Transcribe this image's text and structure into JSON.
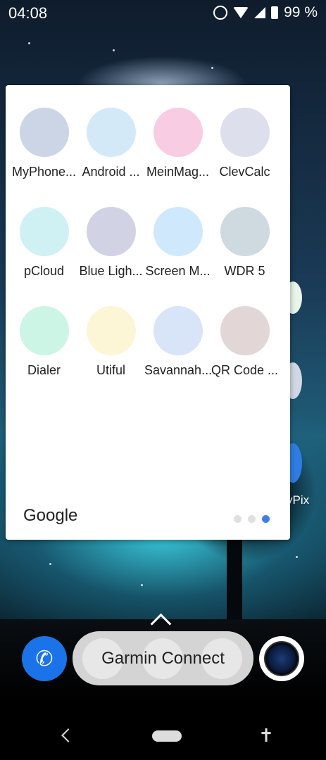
{
  "status_bar": {
    "time": "04:08",
    "battery": "99 %",
    "icons": [
      "alarm-icon",
      "wifi-icon",
      "signal-icon",
      "battery-icon"
    ]
  },
  "folder": {
    "name": "Google",
    "apps": [
      {
        "label": "MyPhone...",
        "color": "#cbd5e6"
      },
      {
        "label": "Android ...",
        "color": "#d4e9f8"
      },
      {
        "label": "MeinMag...",
        "color": "#f8cde3"
      },
      {
        "label": "ClevCalc",
        "color": "#dde0ec"
      },
      {
        "label": "pCloud",
        "color": "#cff1f3"
      },
      {
        "label": "Blue Ligh...",
        "color": "#d1d3e5"
      },
      {
        "label": "Screen M...",
        "color": "#d0e8fb"
      },
      {
        "label": "WDR 5",
        "color": "#cfd9e0"
      },
      {
        "label": "Dialer",
        "color": "#cdf5e5"
      },
      {
        "label": "Utiful",
        "color": "#fcf6d6"
      },
      {
        "label": "Savannah...",
        "color": "#d8e4f8"
      },
      {
        "label": "QR Code ...",
        "color": "#e3d6d6"
      }
    ],
    "pages": 3,
    "current_page": 3,
    "accent_color": "#3f7fe4"
  },
  "home_screen": {
    "partial_label": "yPix"
  },
  "dock": {
    "search_text": "Garmin Connect",
    "left_icon": "phone-icon",
    "right_icon": "camera-icon"
  },
  "nav_bar": {
    "buttons": [
      "back-icon",
      "home-icon",
      "accessibility-icon"
    ]
  }
}
